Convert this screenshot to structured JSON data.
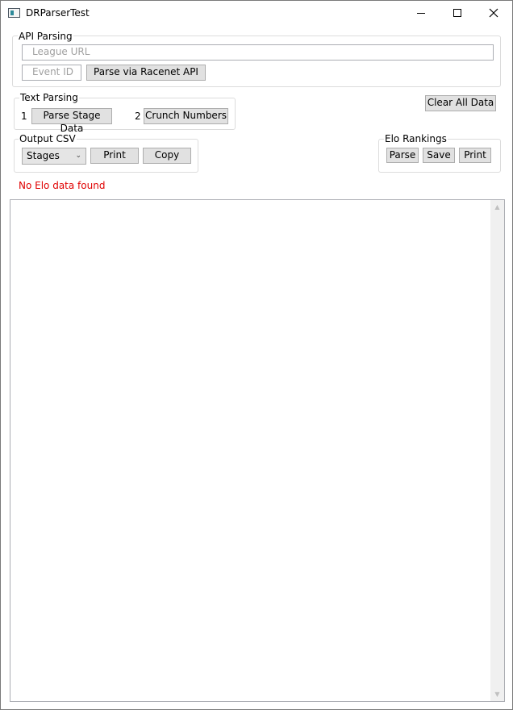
{
  "window": {
    "title": "DRParserTest"
  },
  "api_parsing": {
    "group_label": "API Parsing",
    "league_url_placeholder": "League URL",
    "event_id_placeholder": "Event ID",
    "parse_button": "Parse via Racenet API"
  },
  "text_parsing": {
    "group_label": "Text Parsing",
    "step1_num": "1",
    "step1_button": "Parse Stage Data",
    "step2_num": "2",
    "step2_button": "Crunch Numbers"
  },
  "clear_all_button": "Clear All Data",
  "output_csv": {
    "group_label": "Output CSV",
    "selected_option": "Stages",
    "print_button": "Print",
    "copy_button": "Copy"
  },
  "elo_rankings": {
    "group_label": "Elo Rankings",
    "parse_button": "Parse",
    "save_button": "Save",
    "print_button": "Print"
  },
  "status_message": "No Elo data found",
  "colors": {
    "status_error": "#e00000",
    "button_bg": "#e1e1e1"
  }
}
